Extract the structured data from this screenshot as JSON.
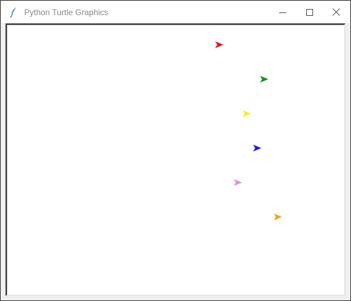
{
  "window": {
    "title": "Python Turtle Graphics",
    "app_icon": "feather-icon",
    "controls": [
      {
        "name": "minimize-button",
        "icon": "minimize-icon"
      },
      {
        "name": "maximize-button",
        "icon": "maximize-icon"
      },
      {
        "name": "close-button",
        "icon": "close-icon"
      }
    ]
  },
  "canvas": {
    "background": "#ffffff",
    "turtles": [
      {
        "name": "red",
        "color": "#e21a1a",
        "heading": "right"
      },
      {
        "name": "green",
        "color": "#1a8c1a",
        "heading": "right"
      },
      {
        "name": "yellow",
        "color": "#f5f01a",
        "heading": "right"
      },
      {
        "name": "blue",
        "color": "#1a1ae6",
        "heading": "right"
      },
      {
        "name": "violet",
        "color": "#e58ae5",
        "heading": "right"
      },
      {
        "name": "orange",
        "color": "#f5a21a",
        "heading": "right"
      }
    ]
  }
}
